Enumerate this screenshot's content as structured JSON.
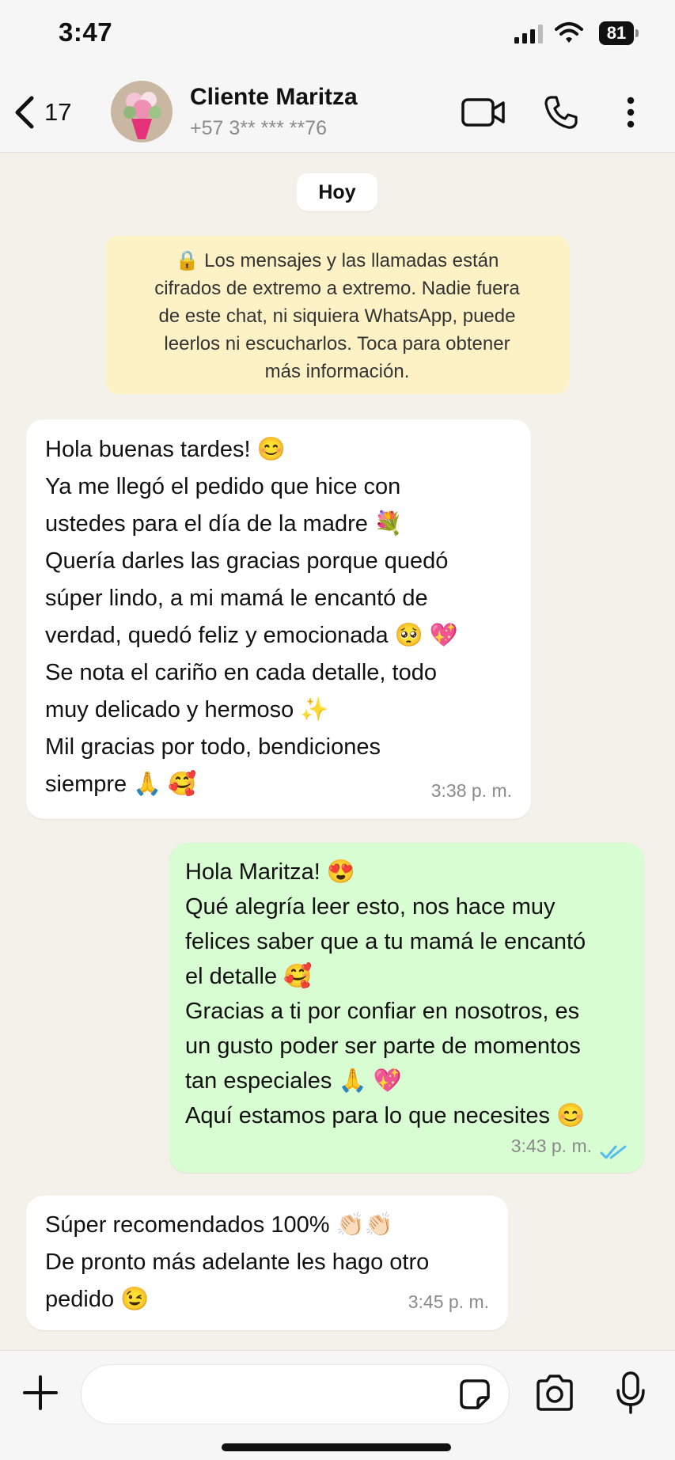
{
  "status_bar": {
    "time": "3:47",
    "battery": "81"
  },
  "header": {
    "back_count": "17",
    "contact_name": "Cliente Maritza",
    "contact_phone": "+57 3** *** **76",
    "icons": [
      "chevron-left-icon",
      "video-call-icon",
      "phone-icon",
      "more-vertical-icon"
    ]
  },
  "chat": {
    "day_label": "Hoy",
    "encryption_notice": [
      "🔒 Los mensajes y las llamadas están",
      "cifrados de extremo a extremo. Nadie fuera",
      "de este chat, ni siquiera WhatsApp, puede",
      "leerlos ni escucharlos. Toca para obtener",
      "más información."
    ],
    "messages": [
      {
        "direction": "incoming",
        "lines": [
          "Hola buenas tardes! 😊",
          "Ya me llegó el pedido que hice con",
          "ustedes para el día de la madre 💐",
          "Quería darles las gracias porque quedó",
          "súper lindo, a mi mamá le encantó de",
          "verdad, quedó feliz y emocionada 🥺 💖",
          "Se nota el cariño en cada detalle, todo",
          "muy delicado y hermoso ✨",
          "Mil gracias por todo, bendiciones",
          "siempre 🙏 🥰"
        ],
        "time": "3:38 p. m."
      },
      {
        "direction": "outgoing",
        "lines": [
          "Hola Maritza! 😍",
          "Qué alegría leer esto, nos hace muy",
          "felices saber que a tu mamá le encantó",
          "el detalle 🥰",
          "Gracias a ti por confiar en nosotros, es",
          "un gusto poder ser parte de momentos",
          "tan especiales 🙏 💖",
          "Aquí estamos para lo que necesites 😊"
        ],
        "time": "3:43 p. m.",
        "read_receipt": "double-check-icon",
        "read_color": "#53bdeb"
      },
      {
        "direction": "incoming",
        "lines": [
          "Súper recomendados 100% 👏🏻👏🏻",
          "De pronto más adelante les hago otro",
          "pedido 😉"
        ],
        "time": "3:45 p. m."
      }
    ]
  },
  "input_bar": {
    "icons": [
      "plus-icon",
      "sticker-icon",
      "camera-icon",
      "microphone-icon"
    ]
  },
  "colors": {
    "incoming_bubble": "#ffffff",
    "outgoing_bubble": "#d9fdd3",
    "chat_background": "#f4f1ea",
    "encryption_notice": "#fdf2c6"
  }
}
